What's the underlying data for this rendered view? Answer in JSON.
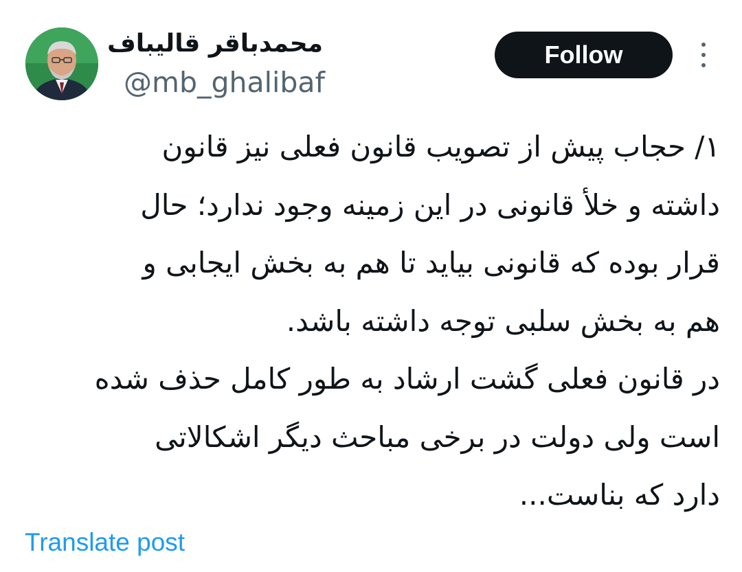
{
  "author": {
    "display_name": "محمدباقر قالیباف",
    "handle": "@mb_ghalibaf",
    "avatar_icon": "profile-photo"
  },
  "actions": {
    "follow_label": "Follow",
    "more_icon": "vertical-ellipsis-icon"
  },
  "tweet": {
    "lines": [
      "۱/ حجاب پیش از تصویب قانون فعلی نیز قانون",
      "داشته و خلأ قانونی در این زمینه وجود ندارد؛ حال",
      "قرار بوده که قانونی بیاید تا هم به بخش ایجابی و",
      "هم به بخش سلبی توجه داشته باشد.",
      "در قانون فعلی گشت ارشاد به طور کامل حذف شده",
      "است ولی دولت در برخی مباحث دیگر اشکالاتی",
      "دارد که بناست..."
    ]
  },
  "footer": {
    "translate_label": "Translate post"
  },
  "colors": {
    "follow_bg": "#0f1419",
    "link": "#1d9bf0",
    "secondary_text": "#536471"
  }
}
